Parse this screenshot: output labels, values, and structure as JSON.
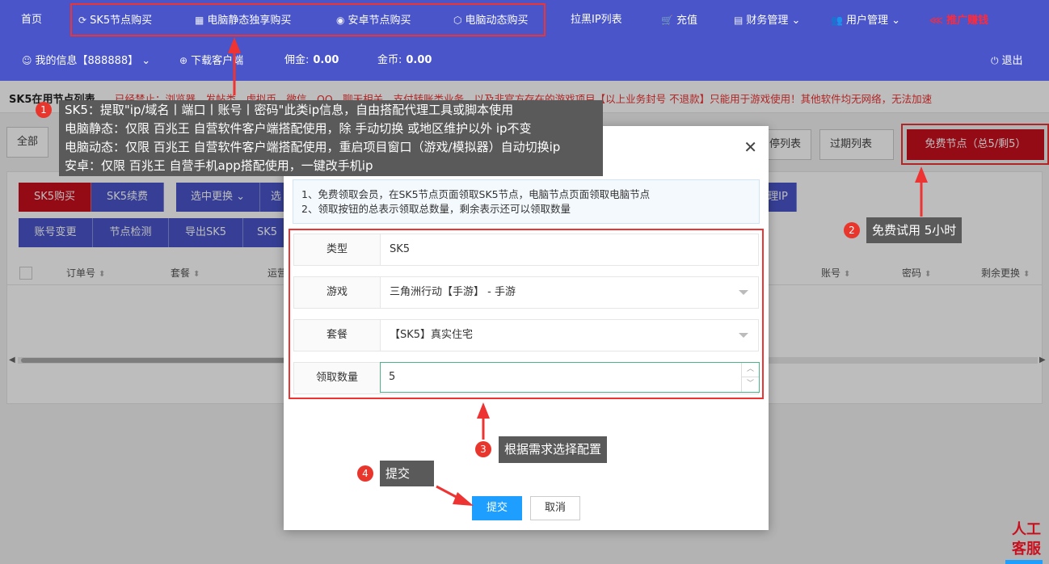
{
  "nav": {
    "home": "首页",
    "sk5_buy": "SK5节点购买",
    "pc_static": "电脑静态独享购买",
    "android": "安卓节点购买",
    "pc_dynamic": "电脑动态购买",
    "blacklist": "拉黑IP列表",
    "recharge": "充值",
    "finance": "财务管理",
    "users": "用户管理",
    "promo": "推广赚钱",
    "my_info": "我的信息【888888】",
    "download": "下载客户端",
    "commission_label": "佣金:",
    "commission_value": "0.00",
    "coins_label": "金币:",
    "coins_value": "0.00",
    "logout": "退出"
  },
  "banner": {
    "title": "SK5在用节点列表",
    "warning": "已经禁止：浏览器、发帖类、虚拟币、微信、QQ、聊天相关、支付转账类业务，以及非官方存在的游戏项目【以上业务封号 不退款】只能用于游戏使用！其他软件均无网络，无法加速"
  },
  "tabs": {
    "all": "全部",
    "paused": "停列表",
    "expired": "过期列表",
    "free": "免费节点（总5/剩5）"
  },
  "toolbar": {
    "sk5_buy": "SK5购买",
    "sk5_renew": "SK5续费",
    "select_change": "选中更换",
    "more_short": "选",
    "ip_btn": "理IP",
    "account_change": "账号变更",
    "node_check": "节点检测",
    "export_sk5": "导出SK5",
    "sk5_more": "SK5"
  },
  "table": {
    "headers": [
      "订单号",
      "套餐",
      "运营",
      "账号",
      "密码",
      "剩余更换"
    ]
  },
  "modal": {
    "tip_line1": "1、免费领取会员，在SK5节点页面领取SK5节点，电脑节点页面领取电脑节点",
    "tip_line2": "2、领取按钮的总表示领取总数量，剩余表示还可以领取数量",
    "type_label": "类型",
    "type_value": "SK5",
    "game_label": "游戏",
    "game_value": "三角洲行动【手游】 - 手游",
    "plan_label": "套餐",
    "plan_value": "【SK5】真实住宅",
    "qty_label": "领取数量",
    "qty_value": "5",
    "submit": "提交",
    "cancel": "取消"
  },
  "annotations": {
    "a1_num": "1",
    "a1_lines": [
      "SK5：提取\"ip/域名丨端口丨账号丨密码\"此类ip信息，自由搭配代理工具或脚本使用",
      "电脑静态：仅限 百兆王 自营软件客户端搭配使用，除 手动切换 或地区维护以外 ip不变",
      "电脑动态：仅限 百兆王 自营软件客户端搭配使用，重启项目窗口（游戏/模拟器）自动切换ip",
      "安卓：仅限 百兆王 自营手机app搭配使用，一键改手机ip"
    ],
    "a2_num": "2",
    "a2_text": "免费试用 5小时",
    "a3_num": "3",
    "a3_text": "根据需求选择配置",
    "a4_num": "4",
    "a4_text": "提交"
  },
  "kefu": {
    "line1": "人工",
    "line2": "客服"
  },
  "colors": {
    "nav_bg": "#4955c9",
    "accent_red": "#c8101e",
    "submit_blue": "#1e9fff",
    "annotation_red": "#e33333"
  }
}
